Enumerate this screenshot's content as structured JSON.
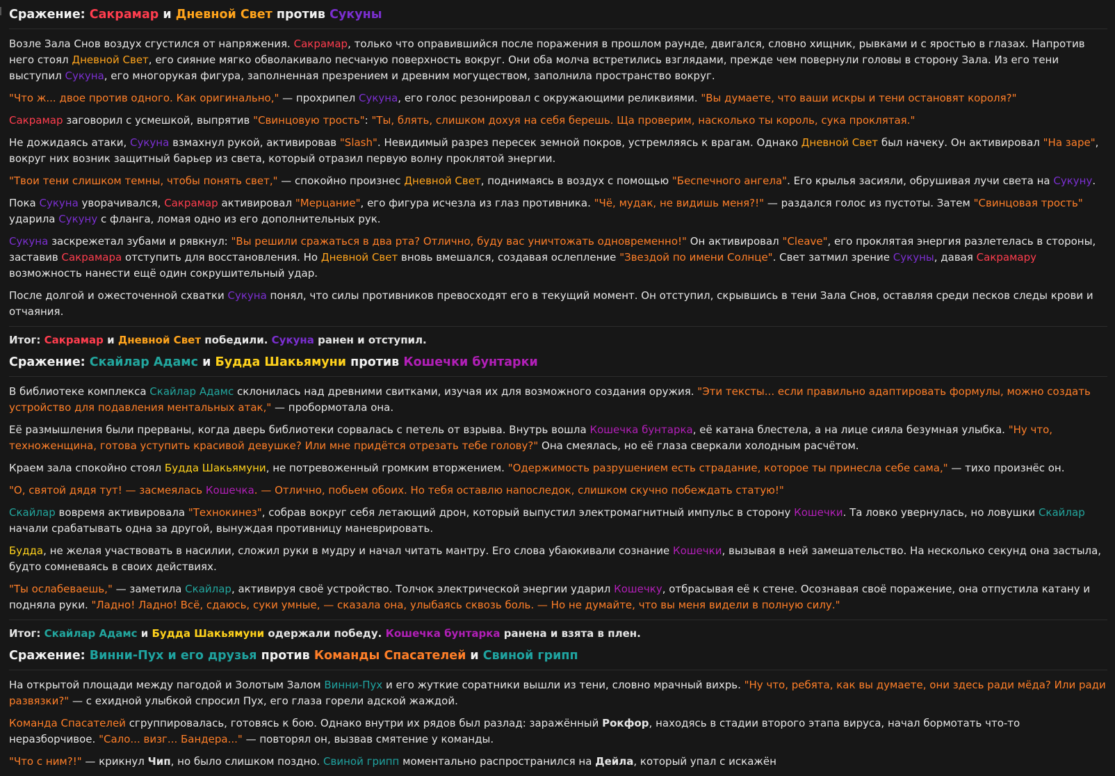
{
  "colors": {
    "default": "#e6e6e6",
    "heading": "#f2f2f2",
    "sakramar": "#ff3d4e",
    "daylight": "#ffa41c",
    "sukuna": "#7b2fd0",
    "quote": "#ff7f28",
    "skylar": "#22a69e",
    "buddha": "#ffd21c",
    "cat": "#b21fb8",
    "pooh": "#1fa3a0",
    "rescue": "#ff7f28",
    "flu": "#1fa3a0"
  },
  "blocks": [
    {
      "type": "heading",
      "segments": [
        {
          "t": "Сражение: "
        },
        {
          "t": "Сакрамар",
          "c": "sakramar"
        },
        {
          "t": " и "
        },
        {
          "t": "Дневной Свет",
          "c": "daylight"
        },
        {
          "t": " против "
        },
        {
          "t": "Сукуны",
          "c": "sukuna"
        }
      ]
    },
    {
      "type": "para",
      "segments": [
        {
          "t": "Возле Зала Снов воздух сгустился от напряжения. "
        },
        {
          "t": "Сакрамар",
          "c": "sakramar"
        },
        {
          "t": ", только что оправившийся после поражения в прошлом раунде, двигался, словно хищник, рывками и с яростью в глазах. Напротив него стоял "
        },
        {
          "t": "Дневной Свет",
          "c": "daylight"
        },
        {
          "t": ", его сияние мягко обволакивало песчаную поверхность вокруг. Они оба молча встретились взглядами, прежде чем повернули головы в сторону Зала. Из его тени выступил "
        },
        {
          "t": "Сукуна",
          "c": "sukuna"
        },
        {
          "t": ", его многорукая фигура, заполненная презрением и древним могуществом, заполнила пространство вокруг."
        }
      ]
    },
    {
      "type": "para",
      "segments": [
        {
          "t": "\"Что ж... двое против одного. Как оригинально,\"",
          "c": "quote"
        },
        {
          "t": " — прохрипел "
        },
        {
          "t": "Сукуна",
          "c": "sukuna"
        },
        {
          "t": ", его голос резонировал с окружающими реликвиями. "
        },
        {
          "t": "\"Вы думаете, что ваши искры и тени остановят короля?\"",
          "c": "quote"
        }
      ]
    },
    {
      "type": "para",
      "segments": [
        {
          "t": "Сакрамар",
          "c": "sakramar"
        },
        {
          "t": " заговорил с усмешкой, выпрятив "
        },
        {
          "t": "\"Свинцовую трость\"",
          "c": "quote"
        },
        {
          "t": ": "
        },
        {
          "t": "\"Ты, блять, слишком дохуя на себя берешь. Ща проверим, насколько ты король, сука проклятая.\"",
          "c": "quote"
        }
      ]
    },
    {
      "type": "para",
      "segments": [
        {
          "t": "Не дожидаясь атаки, "
        },
        {
          "t": "Сукуна",
          "c": "sukuna"
        },
        {
          "t": " взмахнул рукой, активировав "
        },
        {
          "t": "\"Slash\"",
          "c": "quote"
        },
        {
          "t": ". Невидимый разрез пересек земной покров, устремляясь к врагам. Однако "
        },
        {
          "t": "Дневной Свет",
          "c": "daylight"
        },
        {
          "t": " был начеку. Он активировал "
        },
        {
          "t": "\"На заре\"",
          "c": "quote"
        },
        {
          "t": ", вокруг них возник защитный барьер из света, который отразил первую волну проклятой энергии."
        }
      ]
    },
    {
      "type": "para",
      "segments": [
        {
          "t": "\"Твои тени слишком темны, чтобы понять свет,\"",
          "c": "quote"
        },
        {
          "t": " — спокойно произнес "
        },
        {
          "t": "Дневной Свет",
          "c": "daylight"
        },
        {
          "t": ", поднимаясь в воздух с помощью "
        },
        {
          "t": "\"Беспечного ангела\"",
          "c": "quote"
        },
        {
          "t": ". Его крылья засияли, обрушивая лучи света на "
        },
        {
          "t": "Сукуну",
          "c": "sukuna"
        },
        {
          "t": "."
        }
      ]
    },
    {
      "type": "para",
      "segments": [
        {
          "t": "Пока "
        },
        {
          "t": "Сукуна",
          "c": "sukuna"
        },
        {
          "t": " уворачивался, "
        },
        {
          "t": "Сакрамар",
          "c": "sakramar"
        },
        {
          "t": " активировал "
        },
        {
          "t": "\"Мерцание\"",
          "c": "quote"
        },
        {
          "t": ", его фигура исчезла из глаз противника. "
        },
        {
          "t": "\"Чё, мудак, не видишь меня?!\"",
          "c": "quote"
        },
        {
          "t": " — раздался голос из пустоты. Затем "
        },
        {
          "t": "\"Свинцовая трость\"",
          "c": "quote"
        },
        {
          "t": " ударила "
        },
        {
          "t": "Сукуну",
          "c": "sukuna"
        },
        {
          "t": " с фланга, ломая одно из его дополнительных рук."
        }
      ]
    },
    {
      "type": "para",
      "segments": [
        {
          "t": "Сукуна",
          "c": "sukuna"
        },
        {
          "t": " заскрежетал зубами и рявкнул: "
        },
        {
          "t": "\"Вы решили сражаться в два рта? Отлично, буду вас уничтожать одновременно!\"",
          "c": "quote"
        },
        {
          "t": " Он активировал "
        },
        {
          "t": "\"Cleave\"",
          "c": "quote"
        },
        {
          "t": ", его проклятая энергия разлетелась в стороны, заставив "
        },
        {
          "t": "Сакрамара",
          "c": "sakramar"
        },
        {
          "t": " отступить для восстановления. Но "
        },
        {
          "t": "Дневной Свет",
          "c": "daylight"
        },
        {
          "t": " вновь вмешался, создавая ослепление "
        },
        {
          "t": "\"Звездой по имени Солнце\"",
          "c": "quote"
        },
        {
          "t": ". Свет затмил зрение "
        },
        {
          "t": "Сукуны",
          "c": "sukuna"
        },
        {
          "t": ", давая "
        },
        {
          "t": "Сакрамару",
          "c": "sakramar"
        },
        {
          "t": " возможность нанести ещё один сокрушительный удар."
        }
      ]
    },
    {
      "type": "para",
      "segments": [
        {
          "t": "После долгой и ожесточенной схватки "
        },
        {
          "t": "Сукуна",
          "c": "sukuna"
        },
        {
          "t": " понял, что силы противников превосходят его в текущий момент. Он отступил, скрывшись в тени Зала Снов, оставляя среди песков следы крови и отчаяния."
        }
      ]
    },
    {
      "type": "result",
      "segments": [
        {
          "t": "Итог: "
        },
        {
          "t": "Сакрамар",
          "c": "sakramar"
        },
        {
          "t": " и "
        },
        {
          "t": "Дневной Свет",
          "c": "daylight"
        },
        {
          "t": " победили. "
        },
        {
          "t": "Сукуна",
          "c": "sukuna"
        },
        {
          "t": " ранен и отступил."
        }
      ]
    },
    {
      "type": "heading",
      "segments": [
        {
          "t": "Сражение: "
        },
        {
          "t": "Скайлар Адамс",
          "c": "skylar"
        },
        {
          "t": " и "
        },
        {
          "t": "Будда Шакьямуни",
          "c": "buddha"
        },
        {
          "t": " против "
        },
        {
          "t": "Кошечки бунтарки",
          "c": "cat"
        }
      ]
    },
    {
      "type": "para",
      "segments": [
        {
          "t": "В библиотеке комплекса "
        },
        {
          "t": "Скайлар Адамс",
          "c": "skylar"
        },
        {
          "t": " склонилась над древними свитками, изучая их для возможного создания оружия. "
        },
        {
          "t": "\"Эти тексты... если правильно адаптировать формулы, можно создать устройство для подавления ментальных атак,\"",
          "c": "quote"
        },
        {
          "t": " — пробормотала она."
        }
      ]
    },
    {
      "type": "para",
      "segments": [
        {
          "t": "Её размышления были прерваны, когда дверь библиотеки сорвалась с петель от взрыва. Внутрь вошла "
        },
        {
          "t": "Кошечка бунтарка",
          "c": "cat"
        },
        {
          "t": ", её катана блестела, а на лице сияла безумная улыбка. "
        },
        {
          "t": "\"Ну что, техноженщина, готова уступить красивой девушке? Или мне придётся отрезать тебе голову?\"",
          "c": "quote"
        },
        {
          "t": " Она смеялась, но её глаза сверкали холодным расчётом."
        }
      ]
    },
    {
      "type": "para",
      "segments": [
        {
          "t": "Краем зала спокойно стоял "
        },
        {
          "t": "Будда Шакьямуни",
          "c": "buddha"
        },
        {
          "t": ", не потревоженный громким вторжением. "
        },
        {
          "t": "\"Одержимость разрушением есть страдание, которое ты принесла себе сама,\"",
          "c": "quote"
        },
        {
          "t": " — тихо произнёс он."
        }
      ]
    },
    {
      "type": "para",
      "segments": [
        {
          "t": "\"О, святой дядя тут! — засмеялась ",
          "c": "quote"
        },
        {
          "t": "Кошечка",
          "c": "cat"
        },
        {
          "t": ". — Отлично, побьем обоих. Но тебя оставлю напоследок, слишком скучно побеждать статую!\"",
          "c": "quote"
        }
      ]
    },
    {
      "type": "para",
      "segments": [
        {
          "t": "Скайлар",
          "c": "skylar"
        },
        {
          "t": " вовремя активировала "
        },
        {
          "t": "\"Технокинез\"",
          "c": "quote"
        },
        {
          "t": ", собрав вокруг себя летающий дрон, который выпустил электромагнитный импульс в сторону "
        },
        {
          "t": "Кошечки",
          "c": "cat"
        },
        {
          "t": ". Та ловко увернулась, но ловушки "
        },
        {
          "t": "Скайлар",
          "c": "skylar"
        },
        {
          "t": " начали срабатывать одна за другой, вынуждая противницу маневрировать."
        }
      ]
    },
    {
      "type": "para",
      "segments": [
        {
          "t": "Будда",
          "c": "buddha"
        },
        {
          "t": ", не желая участвовать в насилии, сложил руки в мудру и начал читать мантру. Его слова убаюкивали сознание "
        },
        {
          "t": "Кошечки",
          "c": "cat"
        },
        {
          "t": ", вызывая в ней замешательство. На несколько секунд она застыла, будто сомневаясь в своих действиях."
        }
      ]
    },
    {
      "type": "para",
      "segments": [
        {
          "t": "\"Ты ослабеваешь,\"",
          "c": "quote"
        },
        {
          "t": " — заметила "
        },
        {
          "t": "Скайлар",
          "c": "skylar"
        },
        {
          "t": ", активируя своё устройство. Толчок электрической энергии ударил "
        },
        {
          "t": "Кошечку",
          "c": "cat"
        },
        {
          "t": ", отбрасывая её к стене. Осознавая своё поражение, она отпустила катану и подняла руки. "
        },
        {
          "t": "\"Ладно! Ладно! Всё, сдаюсь, суки умные, — сказала она, улыбаясь сквозь боль. — Но не думайте, что вы меня видели в полную силу.\"",
          "c": "quote"
        }
      ]
    },
    {
      "type": "result",
      "segments": [
        {
          "t": "Итог: "
        },
        {
          "t": "Скайлар Адамс",
          "c": "skylar"
        },
        {
          "t": " и "
        },
        {
          "t": "Будда Шакьямуни",
          "c": "buddha"
        },
        {
          "t": " одержали победу. "
        },
        {
          "t": "Кошечка бунтарка",
          "c": "cat"
        },
        {
          "t": " ранена и взята в плен."
        }
      ]
    },
    {
      "type": "heading",
      "segments": [
        {
          "t": "Сражение: "
        },
        {
          "t": "Винни-Пух и его друзья",
          "c": "pooh"
        },
        {
          "t": " против "
        },
        {
          "t": "Команды Спасателей",
          "c": "rescue"
        },
        {
          "t": " и "
        },
        {
          "t": "Свиной грипп",
          "c": "flu"
        }
      ]
    },
    {
      "type": "para",
      "segments": [
        {
          "t": "На открытой площади между пагодой и Золотым Залом "
        },
        {
          "t": "Винни-Пух",
          "c": "pooh"
        },
        {
          "t": " и его жуткие соратники вышли из тени, словно мрачный вихрь. "
        },
        {
          "t": "\"Ну что, ребята, как вы думаете, они здесь ради мёда? Или ради развязки?\"",
          "c": "quote"
        },
        {
          "t": " — с ехидной улыбкой спросил Пух, его глаза горели адской жаждой."
        }
      ]
    },
    {
      "type": "para",
      "segments": [
        {
          "t": "Команда Спасателей",
          "c": "rescue"
        },
        {
          "t": " сгруппировалась, готовясь к бою. Однако внутри их рядов был разлад: заражённый "
        },
        {
          "t": "Рокфор",
          "b": true
        },
        {
          "t": ", находясь в стадии второго этапа вируса, начал бормотать что-то неразборчивое. "
        },
        {
          "t": "\"Сало... визг... Бандера...\"",
          "c": "quote"
        },
        {
          "t": " — повторял он, вызвав смятение у команды."
        }
      ]
    },
    {
      "type": "para",
      "segments": [
        {
          "t": "\"Что с ним?!\"",
          "c": "quote"
        },
        {
          "t": " — крикнул "
        },
        {
          "t": "Чип",
          "b": true
        },
        {
          "t": ", но было слишком поздно. "
        },
        {
          "t": "Свиной грипп",
          "c": "flu"
        },
        {
          "t": " моментально распространился на "
        },
        {
          "t": "Дейла",
          "b": true
        },
        {
          "t": ", который упал с искажён"
        }
      ]
    }
  ]
}
